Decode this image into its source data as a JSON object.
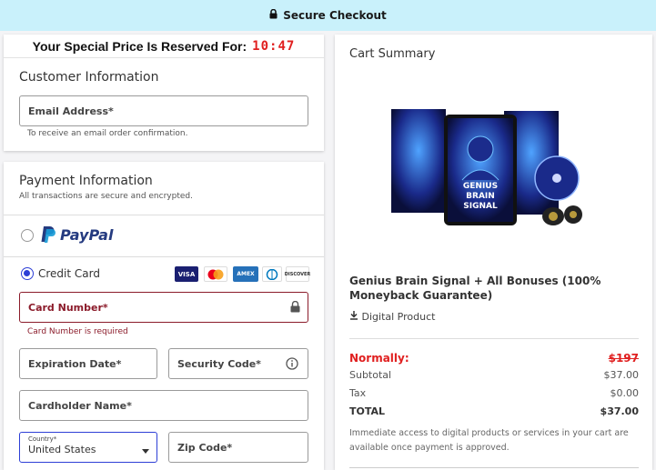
{
  "topbar": {
    "title": "Secure Checkout"
  },
  "timer": {
    "label": "Your Special Price Is Reserved For:",
    "time": "10:47"
  },
  "customer": {
    "title": "Customer Information",
    "email_placeholder": "Email Address*",
    "email_hint": "To receive an email order confirmation."
  },
  "payment": {
    "title": "Payment Information",
    "subtitle": "All transactions are secure and encrypted.",
    "paypal_label": "PayPal",
    "credit_card_label": "Credit Card",
    "cards": [
      "VISA",
      "Mastercard",
      "AMEX",
      "Diners",
      "DISCOVER"
    ],
    "card_number_placeholder": "Card Number*",
    "card_number_error": "Card Number is required",
    "expiration_placeholder": "Expiration Date*",
    "security_code_placeholder": "Security Code*",
    "cardholder_placeholder": "Cardholder Name*",
    "country_label": "Country*",
    "country_value": "United States",
    "zip_placeholder": "Zip Code*"
  },
  "summary": {
    "title": "Cart Summary",
    "product_image_text": "GENIUS BRAIN SIGNAL",
    "product_name": "Genius Brain Signal + All Bonuses (100% Moneyback Guarantee)",
    "product_type": "Digital Product",
    "normally_label": "Normally:",
    "normally_value": "$197",
    "subtotal_label": "Subtotal",
    "subtotal_value": "$37.00",
    "tax_label": "Tax",
    "tax_value": "$0.00",
    "total_label": "TOTAL",
    "total_value": "$37.00",
    "note": "Immediate access to digital products or services in your cart are available once payment is approved."
  },
  "colors": {
    "accent": "#2d3fd6",
    "error": "#8b1b2a",
    "timer": "#e02020",
    "topbar": "#c9f1fb"
  }
}
